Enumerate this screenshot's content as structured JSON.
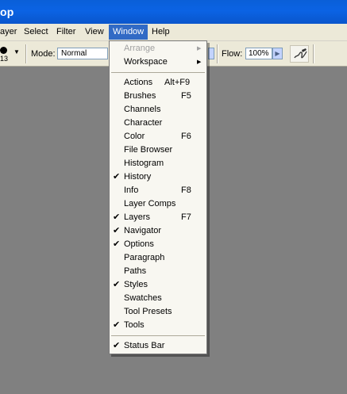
{
  "title": "op",
  "menubar": {
    "items": [
      {
        "label": "ayer"
      },
      {
        "label": "Select"
      },
      {
        "label": "Filter"
      },
      {
        "label": "View"
      },
      {
        "label": "Window"
      },
      {
        "label": "Help"
      }
    ]
  },
  "options": {
    "brush_size": "13",
    "mode_label": "Mode:",
    "mode_value": "Normal",
    "flow_label": "Flow:",
    "flow_value": "100%"
  },
  "window_menu": {
    "items": [
      {
        "label": "Arrange",
        "disabled": true,
        "submenu": true
      },
      {
        "label": "Workspace",
        "submenu": true
      },
      {
        "label": "Actions",
        "shortcut": "Alt+F9"
      },
      {
        "label": "Brushes",
        "shortcut": "F5"
      },
      {
        "label": "Channels"
      },
      {
        "label": "Character"
      },
      {
        "label": "Color",
        "shortcut": "F6"
      },
      {
        "label": "File Browser"
      },
      {
        "label": "Histogram"
      },
      {
        "label": "History",
        "checked": true
      },
      {
        "label": "Info",
        "shortcut": "F8"
      },
      {
        "label": "Layer Comps"
      },
      {
        "label": "Layers",
        "shortcut": "F7",
        "checked": true
      },
      {
        "label": "Navigator",
        "checked": true
      },
      {
        "label": "Options",
        "checked": true
      },
      {
        "label": "Paragraph"
      },
      {
        "label": "Paths"
      },
      {
        "label": "Styles",
        "checked": true
      },
      {
        "label": "Swatches"
      },
      {
        "label": "Tool Presets"
      },
      {
        "label": "Tools",
        "checked": true
      },
      {
        "label": "Status Bar",
        "checked": true
      }
    ],
    "check_glyph": "✔",
    "submenu_glyph": "▶"
  },
  "colors": {
    "titlebar": "#0b63e4",
    "menu_highlight": "#316ac5",
    "workspace": "#808080"
  }
}
